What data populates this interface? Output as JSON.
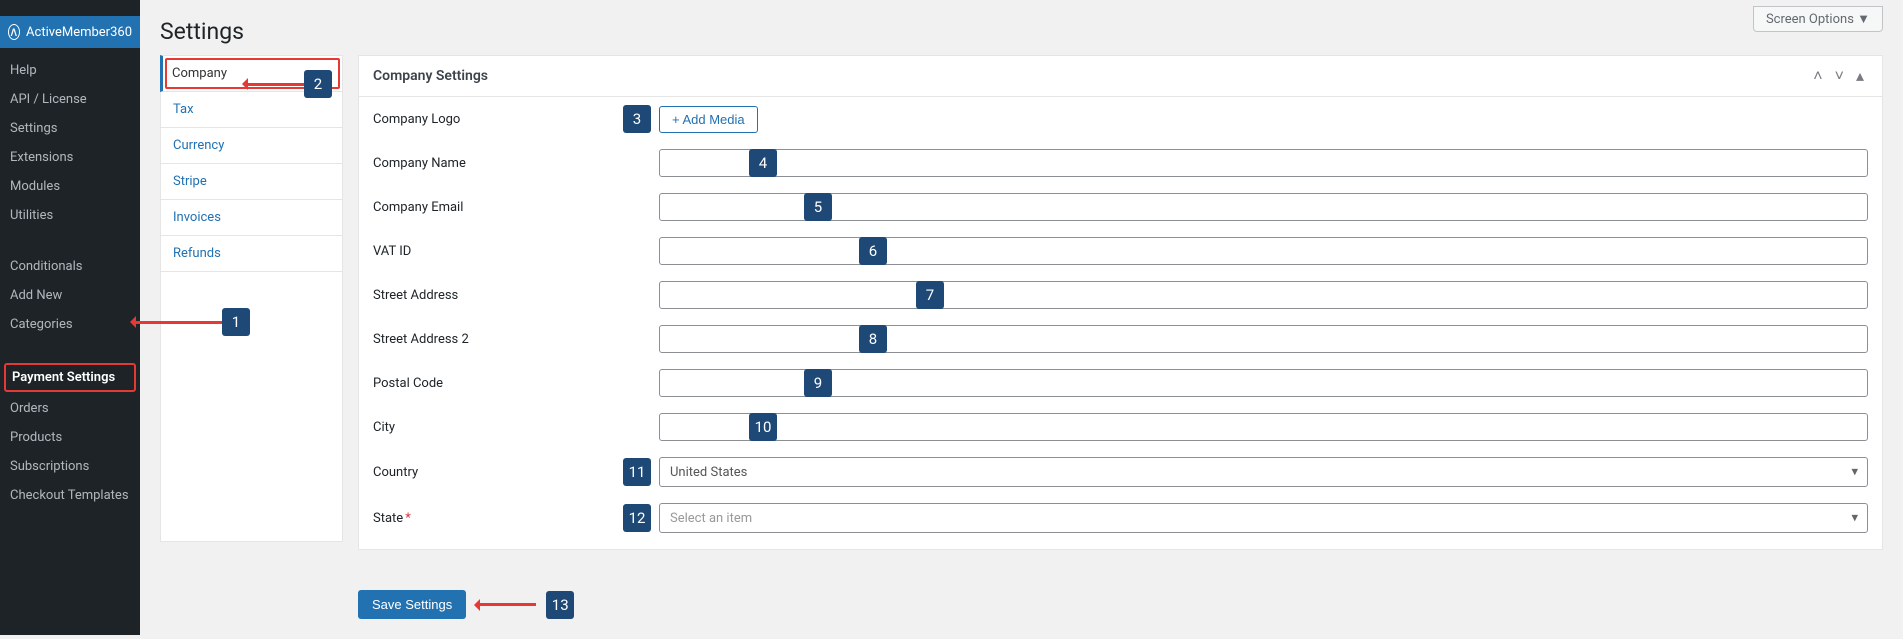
{
  "screen_options": "Screen Options  ▼",
  "page_title": "Settings",
  "sidebar": {
    "brand": "ActiveMember360",
    "items": [
      "Help",
      "API / License",
      "Settings",
      "Extensions",
      "Modules",
      "Utilities"
    ],
    "items2": [
      "Conditionals",
      "Add New",
      "Categories"
    ],
    "items3": [
      "Payment Settings",
      "Orders",
      "Products",
      "Subscriptions",
      "Checkout Templates"
    ]
  },
  "tabs": [
    "Company",
    "Tax",
    "Currency",
    "Stripe",
    "Invoices",
    "Refunds"
  ],
  "panel": {
    "title": "Company Settings",
    "fields": {
      "logo_label": "Company Logo",
      "add_media": "+ Add Media",
      "name_label": "Company Name",
      "email_label": "Company Email",
      "vat_label": "VAT ID",
      "street_label": "Street Address",
      "street2_label": "Street Address 2",
      "postal_label": "Postal Code",
      "city_label": "City",
      "country_label": "Country",
      "country_value": "United States",
      "state_label": "State",
      "state_placeholder": "Select an item"
    },
    "save": "Save Settings"
  },
  "callouts": {
    "n1": "1",
    "n2": "2",
    "n3": "3",
    "n4": "4",
    "n5": "5",
    "n6": "6",
    "n7": "7",
    "n8": "8",
    "n9": "9",
    "n10": "10",
    "n11": "11",
    "n12": "12",
    "n13": "13"
  }
}
